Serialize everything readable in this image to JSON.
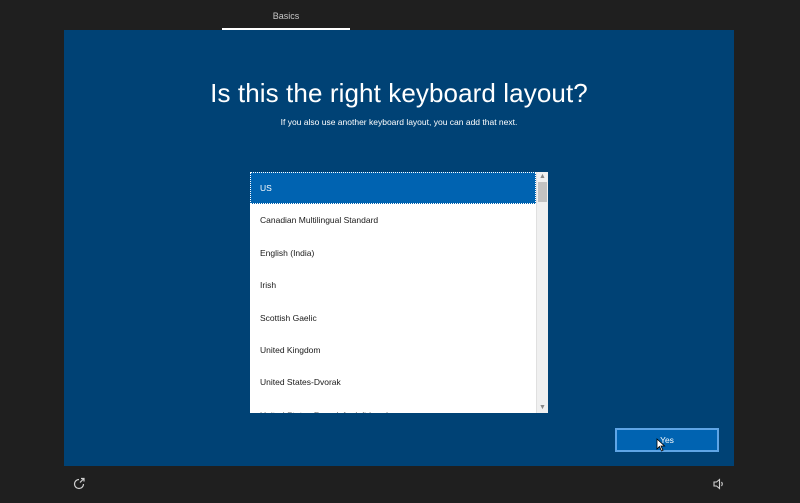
{
  "header": {
    "tab_label": "Basics"
  },
  "page": {
    "title": "Is this the right keyboard layout?",
    "subtitle": "If you also use another keyboard layout, you can add that next."
  },
  "layout_list": {
    "items": [
      "US",
      "Canadian Multilingual Standard",
      "English (India)",
      "Irish",
      "Scottish Gaelic",
      "United Kingdom",
      "United States-Dvorak",
      "United States-Dvorak for left hand"
    ],
    "selected": "US"
  },
  "footer": {
    "yes_label": "Yes",
    "ease_of_access_icon": "ease-of-access-icon",
    "volume_icon": "volume-icon"
  },
  "colors": {
    "panel_background": "#004275",
    "selection": "#0063b1",
    "frame": "#1f1f1f",
    "button_border": "#5fa5e6"
  }
}
